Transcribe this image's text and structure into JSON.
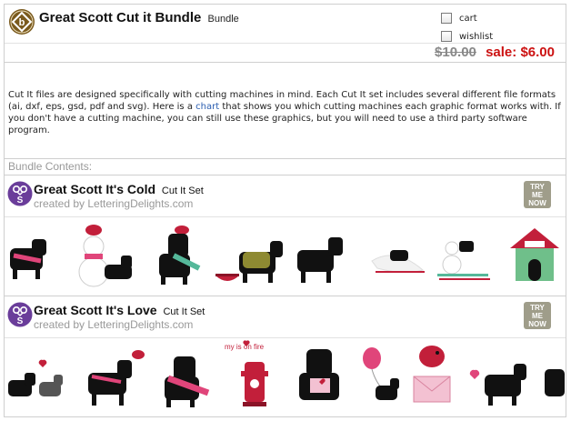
{
  "bundle": {
    "title": "Great Scott Cut it Bundle",
    "type": "Bundle",
    "cart_label": "cart",
    "wishlist_label": "wishlist",
    "old_price": "$10.00",
    "sale_label": "sale:",
    "sale_price": "$6.00"
  },
  "description": {
    "before_link": "Cut It files are designed specifically with cutting machines in mind. Each Cut It set includes several different file formats (ai, dxf, eps, gsd, pdf and svg). Here is a ",
    "link_text": "chart",
    "after_link": " that shows you which cutting machines each graphic format works with. If you don't have a cutting machine, you can still use these graphics, but you will need to use a third party software program."
  },
  "contents_label": "Bundle Contents:",
  "products": [
    {
      "title": "Great Scott It's Cold",
      "type": "Cut It Set",
      "creator": "created by LetteringDelights.com",
      "try_label": [
        "TRY",
        "ME",
        "NOW"
      ]
    },
    {
      "title": "Great Scott It's Love",
      "type": "Cut It Set",
      "creator": "created by LetteringDelights.com",
      "try_label": [
        "TRY",
        "ME",
        "NOW"
      ],
      "art_text": "my  is on fire"
    }
  ],
  "colors": {
    "sale_red": "#cc1111",
    "muted_gray": "#999999",
    "link_blue": "#2a5db0",
    "try_button": "#9f9d8a",
    "set_icon_purple": "#6a3d9a",
    "bundle_logo_brown": "#7a5a1e"
  },
  "icons": {
    "bundle_logo": "bundle-diamond-icon",
    "set_icon": "scissors-s-icon"
  }
}
